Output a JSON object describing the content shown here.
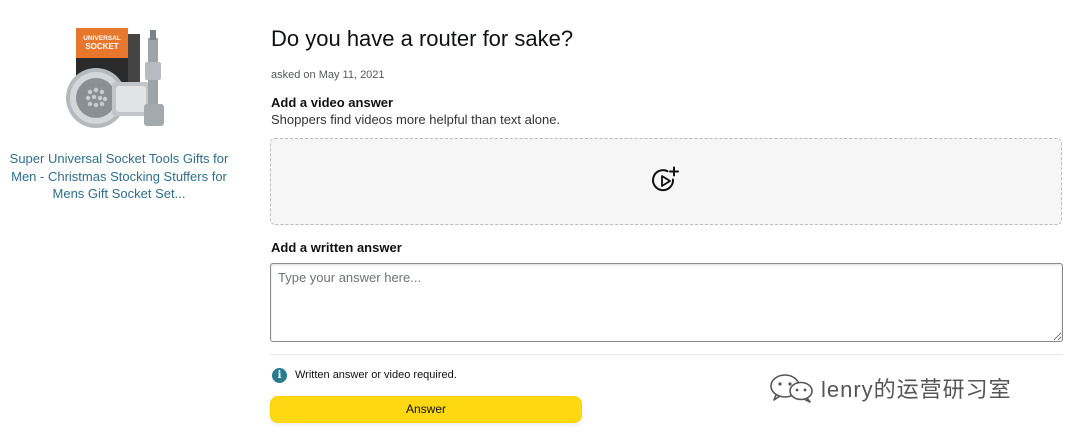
{
  "product": {
    "image": "socket-tool-product-image",
    "box_label_line1": "UNIVERSAL",
    "box_label_line2": "SOCKET",
    "title": "Super Universal Socket Tools Gifts for Men - Christmas Stocking Stuffers for Mens Gift Socket Set..."
  },
  "question": {
    "title": "Do you have a router for sake?",
    "asked": "asked on May 11, 2021"
  },
  "video_answer": {
    "heading": "Add a video answer",
    "subtext": "Shoppers find videos more helpful than text alone.",
    "icon": "add-video-icon"
  },
  "written_answer": {
    "heading": "Add a written answer",
    "value": "",
    "placeholder": "Type your answer here..."
  },
  "requirement_note": {
    "icon": "info-icon",
    "text": "Written answer or video required."
  },
  "answer_button": {
    "label": "Answer"
  },
  "watermark": {
    "icon": "wechat-icon",
    "text": "lenry的运营研习室"
  },
  "colors": {
    "link": "#2f6e8c",
    "button": "#ffd814",
    "info": "#2a7b8f"
  }
}
